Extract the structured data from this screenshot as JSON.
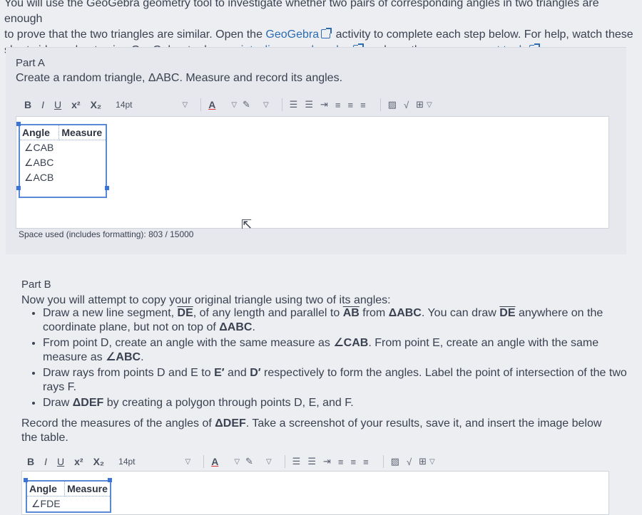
{
  "intro": {
    "line1": "You will use the GeoGebra geometry tool to investigate whether two pairs of corresponding angles in two triangles are enough",
    "line2a": "to prove that the two triangles are similar. Open the ",
    "geogebra_link": "GeoGebra",
    "line2b": " activity to complete each step below. For help, watch these",
    "line3a": "short videos about using GeoGebra to draw ",
    "videos_link": "points, lines, and angles",
    "line3b": " and use the ",
    "tools_link": "measurement tools",
    "line3c": "."
  },
  "part_a": {
    "title": "Part A",
    "description": "Create a random triangle, ΔABC. Measure and record its angles.",
    "table": {
      "headers": [
        "Angle",
        "Measure"
      ],
      "rows": [
        "∠CAB",
        "∠ABC",
        "∠ACB"
      ]
    },
    "space_used": "Space used (includes formatting): 803 / 15000"
  },
  "toolbar": {
    "bold": "B",
    "italic": "I",
    "underline": "U",
    "superscript": "x²",
    "subscript": "X₂",
    "font_size": "14pt",
    "text_color": "A"
  },
  "part_b": {
    "title": "Part B",
    "intro": "Now you will attempt to copy your original triangle using two of its angles:",
    "steps": [
      {
        "a": "Draw a new line segment, ",
        "seg1": "DE",
        "b": ", of any length and parallel to ",
        "seg2": "AB",
        "c": " from ",
        "tri": "ΔABC",
        "d": ". You can draw ",
        "seg3": "DE",
        "e": " anywhere on the coordinate plane, but not on top of ",
        "tri2": "ΔABC",
        "f": "."
      },
      {
        "a": "From point D, create an angle with the same measure as ",
        "ang1": "∠CAB",
        "b": ". From point E, create an angle with the same measure as ",
        "ang2": "∠ABC",
        "c": "."
      },
      {
        "a": "Draw rays from points D and E to ",
        "p1": "E′",
        "b": " and ",
        "p2": "D′",
        "c": " respectively to form the angles. Label the point of intersection of the two rays F."
      },
      {
        "a": "Draw ",
        "tri": "ΔDEF",
        "b": " by creating a polygon through points D, E, and F."
      }
    ],
    "record_a": "Record the measures of the angles of ",
    "record_tri": "ΔDEF",
    "record_b": ". Take a screenshot of your results, save it, and insert the image below the table.",
    "table": {
      "headers": [
        "Angle",
        "Measure"
      ],
      "rows": [
        "∠FDE"
      ]
    }
  }
}
